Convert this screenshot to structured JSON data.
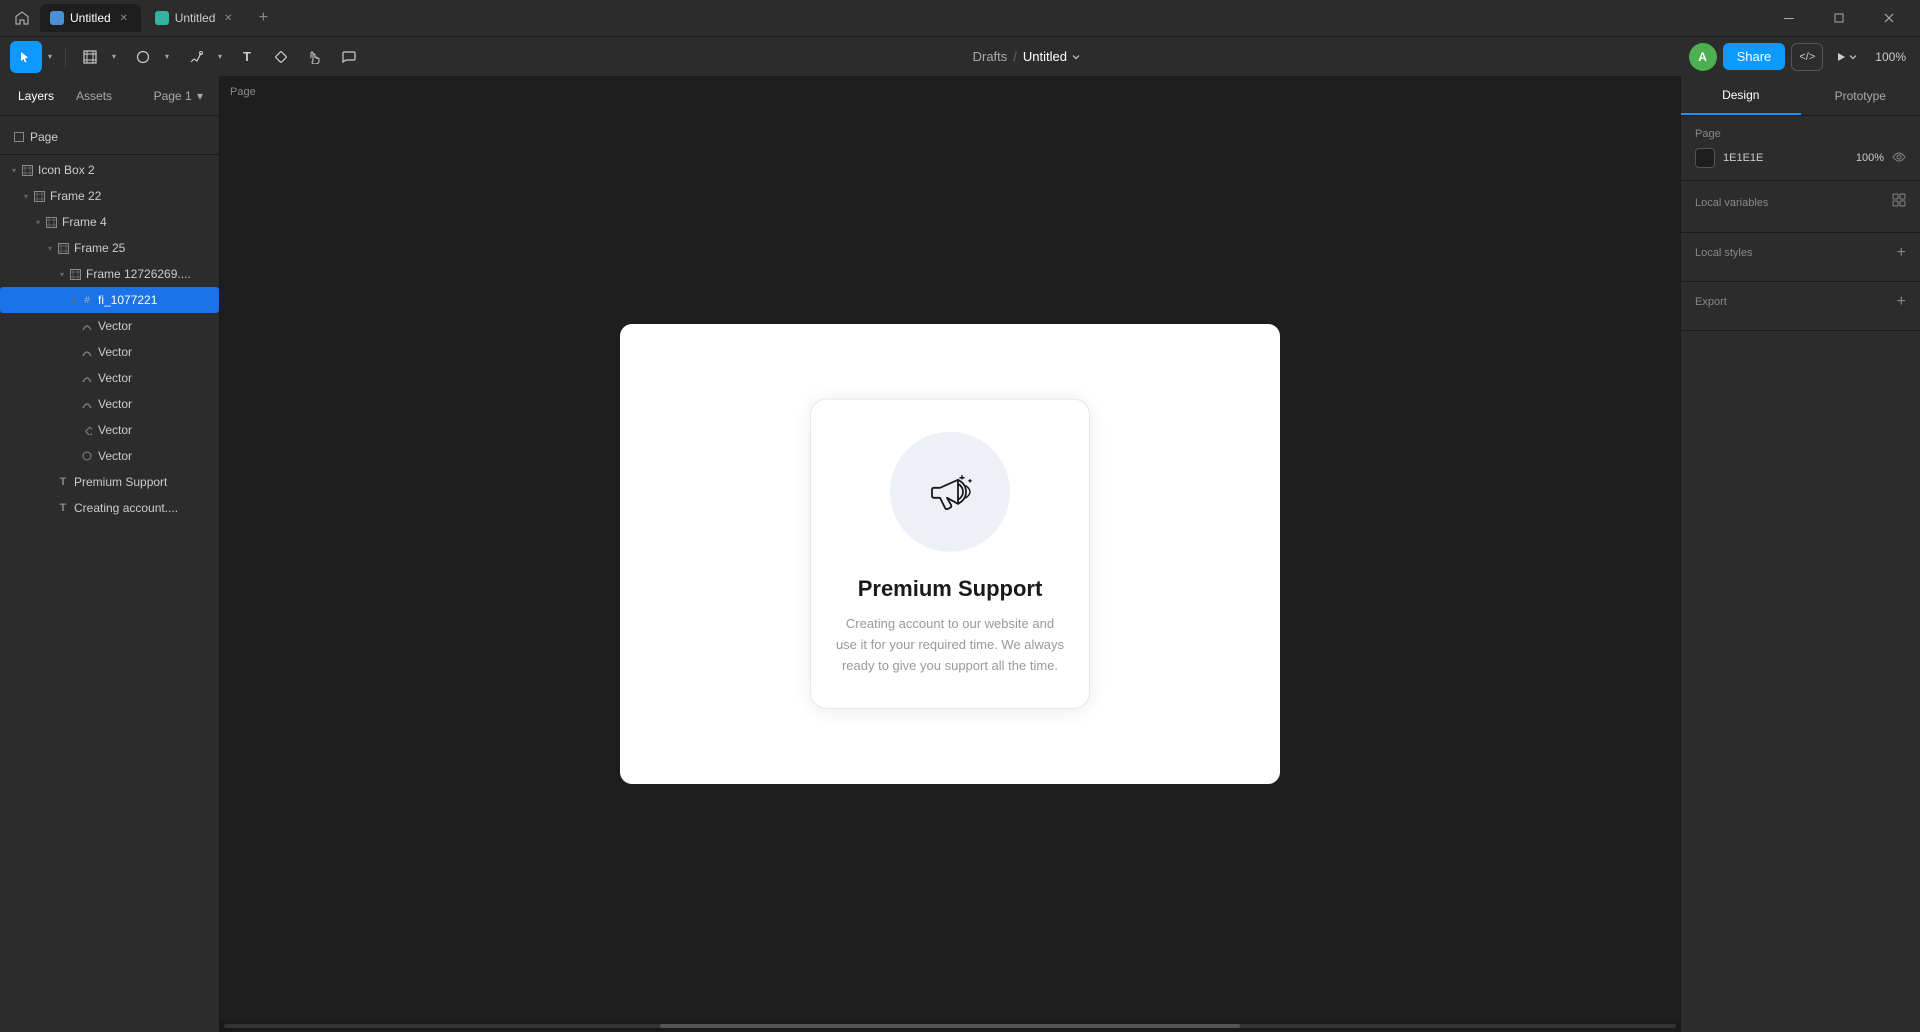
{
  "titlebar": {
    "tabs": [
      {
        "id": "tab1",
        "label": "Untitled",
        "favicon": "blue",
        "active": true
      },
      {
        "id": "tab2",
        "label": "Untitled",
        "favicon": "teal",
        "active": false
      }
    ],
    "add_tab_label": "+",
    "win_controls": {
      "minimize": "–",
      "restore": "❐",
      "close": "✕"
    }
  },
  "toolbar": {
    "tools": [
      {
        "id": "select",
        "icon": "▶",
        "label": "Select",
        "active": true
      },
      {
        "id": "frame",
        "icon": "⊞",
        "label": "Frame",
        "active": false
      },
      {
        "id": "shape",
        "icon": "○",
        "label": "Shape",
        "active": false
      },
      {
        "id": "pen",
        "icon": "✏",
        "label": "Pen",
        "active": false
      },
      {
        "id": "text",
        "icon": "T",
        "label": "Text",
        "active": false
      },
      {
        "id": "component",
        "icon": "⧉",
        "label": "Component",
        "active": false
      },
      {
        "id": "hand",
        "icon": "✋",
        "label": "Hand",
        "active": false
      },
      {
        "id": "comment",
        "icon": "○",
        "label": "Comment",
        "active": false
      }
    ],
    "breadcrumb": {
      "drafts": "Drafts",
      "separator": "/",
      "title": "Untitled",
      "chevron": "▾"
    },
    "avatar_letter": "A",
    "share_label": "Share",
    "code_icon": "</>",
    "play_icon": "▶",
    "zoom_label": "100%"
  },
  "left_panel": {
    "tabs": [
      {
        "id": "layers",
        "label": "Layers",
        "active": true
      },
      {
        "id": "assets",
        "label": "Assets",
        "active": false
      }
    ],
    "page_tab": "Page 1",
    "page_chevron": "▾",
    "sections": {
      "page_label": "Page",
      "layer_items": [
        {
          "id": "icon-box-2",
          "label": "Icon Box 2",
          "depth": 0,
          "icon": "⊞",
          "chevron": "▾"
        },
        {
          "id": "frame-22",
          "label": "Frame 22",
          "depth": 1,
          "icon": "⊞",
          "chevron": "▾"
        },
        {
          "id": "frame-4",
          "label": "Frame 4",
          "depth": 2,
          "icon": "⊞",
          "chevron": "▾"
        },
        {
          "id": "frame-25",
          "label": "Frame 25",
          "depth": 3,
          "icon": "⊞",
          "chevron": "▾"
        },
        {
          "id": "frame-12726",
          "label": "Frame 12726269....",
          "depth": 4,
          "icon": "⊞",
          "chevron": "▾"
        },
        {
          "id": "fi-1077221",
          "label": "fi_1077221",
          "depth": 5,
          "icon": "#",
          "chevron": "▾"
        },
        {
          "id": "vector-1",
          "label": "Vector",
          "depth": 6,
          "icon": "∿"
        },
        {
          "id": "vector-2",
          "label": "Vector",
          "depth": 6,
          "icon": "∿"
        },
        {
          "id": "vector-3",
          "label": "Vector",
          "depth": 6,
          "icon": "∿"
        },
        {
          "id": "vector-4",
          "label": "Vector",
          "depth": 6,
          "icon": "∿"
        },
        {
          "id": "vector-5",
          "label": "Vector",
          "depth": 6,
          "icon": "◆"
        },
        {
          "id": "vector-6",
          "label": "Vector",
          "depth": 6,
          "icon": "○"
        },
        {
          "id": "premium-support",
          "label": "Premium Support",
          "depth": 4,
          "icon": "T"
        },
        {
          "id": "creating-account",
          "label": "Creating account....",
          "depth": 4,
          "icon": "T"
        }
      ]
    }
  },
  "canvas": {
    "label": "Page",
    "frame_label": "",
    "card": {
      "title": "Premium Support",
      "description": "Creating account to our website and use it for your required time. We always ready to give you support all the time."
    }
  },
  "right_panel": {
    "tabs": [
      {
        "id": "design",
        "label": "Design",
        "active": true
      },
      {
        "id": "prototype",
        "label": "Prototype",
        "active": false
      }
    ],
    "page_section": {
      "title": "Page",
      "color_hex": "1E1E1E",
      "opacity": "100%",
      "eye_visible": true
    },
    "local_variables": {
      "title": "Local variables",
      "icon": "⊞"
    },
    "local_styles": {
      "title": "Local styles",
      "add_icon": "+"
    },
    "export": {
      "title": "Export",
      "add_icon": "+"
    }
  }
}
